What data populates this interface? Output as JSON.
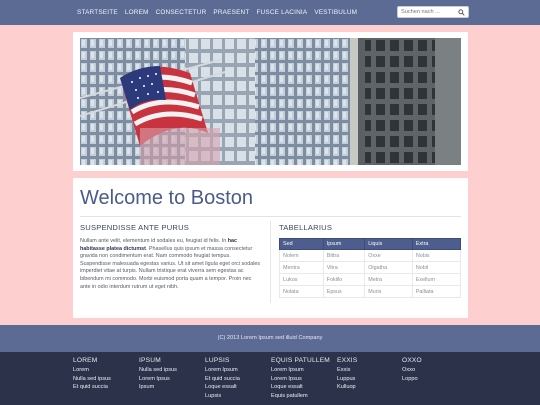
{
  "nav": {
    "items": [
      "STARTSEITE",
      "LOREM",
      "CONSECTETUR",
      "PRAESENT",
      "FUSCE LACINIA",
      "VESTIBULUM"
    ],
    "search_placeholder": "Suchen nach ...",
    "search_icon": "search-icon"
  },
  "hero": {
    "image": "city-buildings-with-american-flag"
  },
  "main": {
    "title": "Welcome to Boston",
    "left_heading": "SUSPENDISSE ANTE PURUS",
    "paragraph": {
      "part1": "Nullam ante velit, elementum id sodales eu, feugiat id felis. In ",
      "bold": "hac habitasse platea dictumst",
      "part2": ". Phasellus quis ipsum et massa consectetur gravida non condimentum erat. Nam commodo feugiat tempus. Suspendisse malesuada egestas varius. Ut sit amet ligula eget orci sodales imperdiet vitae at turpis. Nullam tristique erat viverra sem egestas ac bibendum mi commodo. Morbi euismod porta quam a tempor. Proin nec ante in odio interdum rutrum ut eget nibh."
    },
    "right_heading": "TABELLARIUS",
    "table": {
      "headers": [
        "Sed",
        "Ipsum",
        "Liquis",
        "Extra"
      ],
      "rows": [
        [
          "Nolem",
          "Bittra",
          "Oxxe",
          "Nobis"
        ],
        [
          "Mentra",
          "Vitra",
          "Oigatha",
          "Nobil"
        ],
        [
          "Lukos",
          "Fokillo",
          "Metra",
          "Exellum"
        ],
        [
          "Nolata",
          "Epsus",
          "Muris",
          "Palliata"
        ]
      ]
    }
  },
  "footer": {
    "copyright": "(C) 2013 Lorem Ipsum sed illuid Company",
    "columns": [
      {
        "heading": "LOREM",
        "items": [
          "Lorem",
          "Nulla sed ipsus",
          "Et quid succia"
        ]
      },
      {
        "heading": "IPSUM",
        "items": [
          "Nulla sed ipsus",
          "Lorem Ipsus",
          "Ipsum"
        ]
      },
      {
        "heading": "LUPSIS",
        "items": [
          "Lorem Ipsum",
          "Et quid succia",
          "Loque essalt",
          "Lupsis"
        ]
      },
      {
        "heading": "EQUIS PATULLEM",
        "items": [
          "Lorem Ipsum",
          "Lorem Ipsus",
          "Loque essalt",
          "Equis patullem"
        ]
      },
      {
        "heading": "EXXIS",
        "items": [
          "Exxis",
          "Luppus",
          "Kulluop"
        ]
      },
      {
        "heading": "OXXO",
        "items": [
          "Oxxo",
          "Loppo"
        ]
      }
    ]
  },
  "colors": {
    "background": "#fdcfcf",
    "nav": "#5b6b94",
    "footer_dark": "#2b3249",
    "accent": "#4b5b8b"
  }
}
